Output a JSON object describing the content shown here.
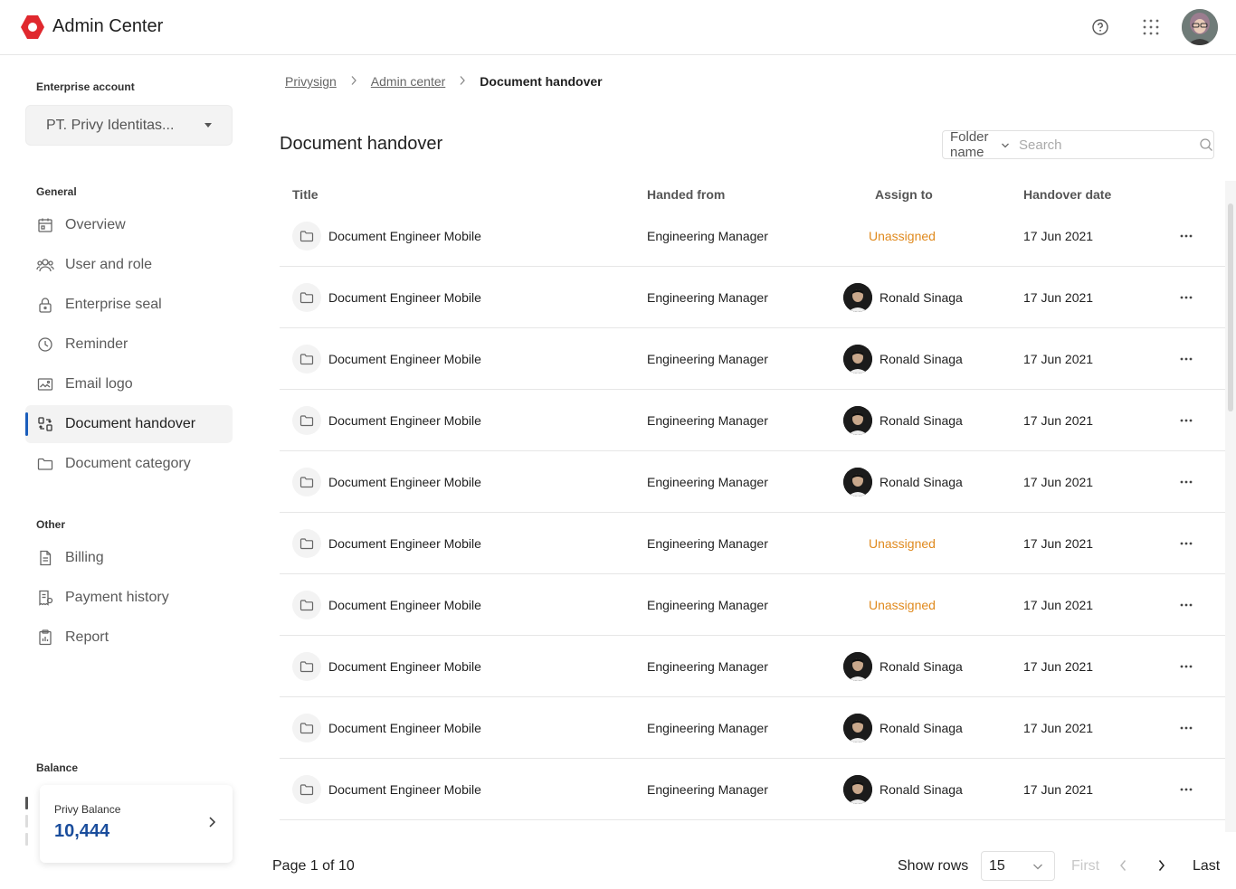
{
  "app": {
    "title": "Admin Center"
  },
  "colors": {
    "brand": "#e0282e",
    "accent": "#1a5dbb",
    "unassigned": "#e08a1e",
    "balance": "#1a4d9c"
  },
  "header_icons": [
    "help-icon",
    "apps-grid-icon",
    "user-avatar"
  ],
  "sidebar": {
    "enterprise_label": "Enterprise account",
    "account_value": "PT. Privy Identitas...",
    "general_label": "General",
    "general_items": [
      {
        "label": "Overview",
        "icon": "calendar-icon"
      },
      {
        "label": "User and role",
        "icon": "users-icon"
      },
      {
        "label": "Enterprise seal",
        "icon": "lock-icon"
      },
      {
        "label": "Reminder",
        "icon": "clock-icon"
      },
      {
        "label": "Email logo",
        "icon": "image-icon"
      },
      {
        "label": "Document handover",
        "icon": "handover-icon",
        "active": true
      },
      {
        "label": "Document category",
        "icon": "folder-icon"
      }
    ],
    "other_label": "Other",
    "other_items": [
      {
        "label": "Billing",
        "icon": "document-icon"
      },
      {
        "label": "Payment history",
        "icon": "receipt-icon"
      },
      {
        "label": "Report",
        "icon": "report-icon"
      }
    ],
    "balance_label": "Balance",
    "balance_card_label": "Privy Balance",
    "balance_value": "10,444"
  },
  "breadcrumb": [
    "Privysign",
    "Admin center",
    "Document handover"
  ],
  "page": {
    "title": "Document handover",
    "filter_value": "Folder name",
    "search_placeholder": "Search"
  },
  "table": {
    "columns": [
      "Title",
      "Handed from",
      "Assign to",
      "Handover date"
    ],
    "rows": [
      {
        "title": "Document Engineer Mobile",
        "from": "Engineering Manager",
        "assign": "Unassigned",
        "assigned": false,
        "date": "17 Jun 2021"
      },
      {
        "title": "Document Engineer Mobile",
        "from": "Engineering Manager",
        "assign": "Ronald Sinaga",
        "assigned": true,
        "date": "17 Jun 2021"
      },
      {
        "title": "Document Engineer Mobile",
        "from": "Engineering Manager",
        "assign": "Ronald Sinaga",
        "assigned": true,
        "date": "17 Jun 2021"
      },
      {
        "title": "Document Engineer Mobile",
        "from": "Engineering Manager",
        "assign": "Ronald Sinaga",
        "assigned": true,
        "date": "17 Jun 2021"
      },
      {
        "title": "Document Engineer Mobile",
        "from": "Engineering Manager",
        "assign": "Ronald Sinaga",
        "assigned": true,
        "date": "17 Jun 2021"
      },
      {
        "title": "Document Engineer Mobile",
        "from": "Engineering Manager",
        "assign": "Unassigned",
        "assigned": false,
        "date": "17 Jun 2021"
      },
      {
        "title": "Document Engineer Mobile",
        "from": "Engineering Manager",
        "assign": "Unassigned",
        "assigned": false,
        "date": "17 Jun 2021"
      },
      {
        "title": "Document Engineer Mobile",
        "from": "Engineering Manager",
        "assign": "Ronald Sinaga",
        "assigned": true,
        "date": "17 Jun 2021"
      },
      {
        "title": "Document Engineer Mobile",
        "from": "Engineering Manager",
        "assign": "Ronald Sinaga",
        "assigned": true,
        "date": "17 Jun 2021"
      },
      {
        "title": "Document Engineer Mobile",
        "from": "Engineering Manager",
        "assign": "Ronald Sinaga",
        "assigned": true,
        "date": "17 Jun 2021"
      }
    ]
  },
  "footer": {
    "page_info": "Page 1 of 10",
    "show_rows_label": "Show rows",
    "rows_value": "15",
    "first_label": "First",
    "last_label": "Last"
  }
}
